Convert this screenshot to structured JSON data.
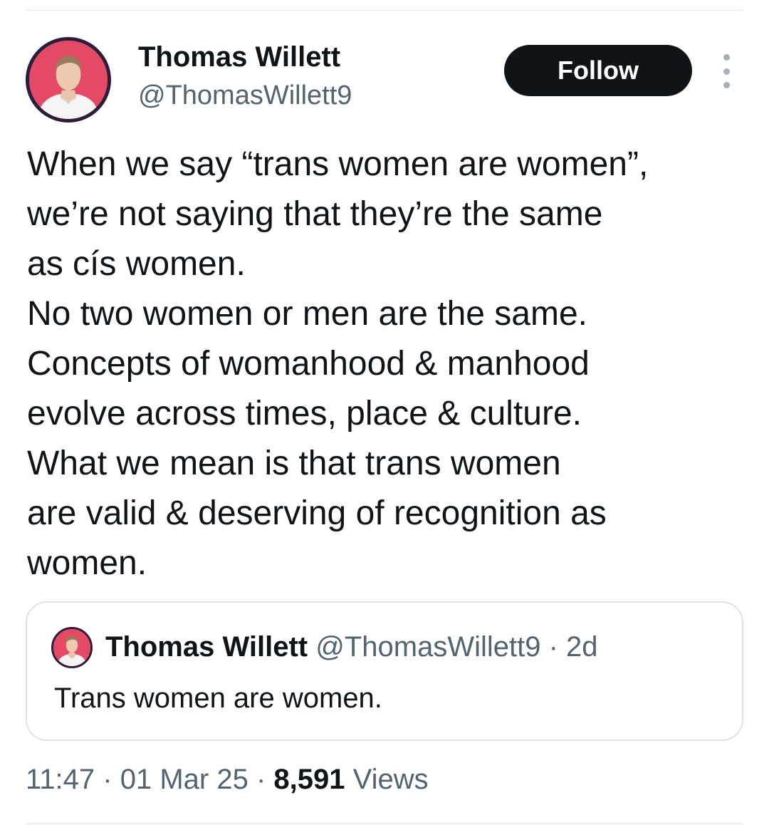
{
  "tweet": {
    "author_name": "Thomas Willett",
    "author_handle": "@ThomasWillett9",
    "follow_label": "Follow",
    "text": "When we say “trans women are women”,\nwe’re not saying that they’re the same\nas cís women.\nNo two women or men are the same.\nConcepts of womanhood & manhood\nevolve across times, place & culture.\nWhat we mean is that trans women\nare valid & deserving of recognition as\nwomen.",
    "time": "11:47",
    "date": "01 Mar 25",
    "separator": "·",
    "views_count": "8,591",
    "views_label": "Views"
  },
  "quote": {
    "author_name": "Thomas Willett",
    "author_handle": "@ThomasWillett9",
    "separator": "·",
    "age": "2d",
    "text": "Trans women are women."
  },
  "icons": {
    "more": "more-vertical-icon",
    "avatar": "avatar-image"
  },
  "colors": {
    "avatar_background": "#e44a66",
    "avatar_ring": "#2b1e3a",
    "follow_button": "#0f1419",
    "secondary_text": "#536471",
    "divider": "#dfe3e6"
  }
}
